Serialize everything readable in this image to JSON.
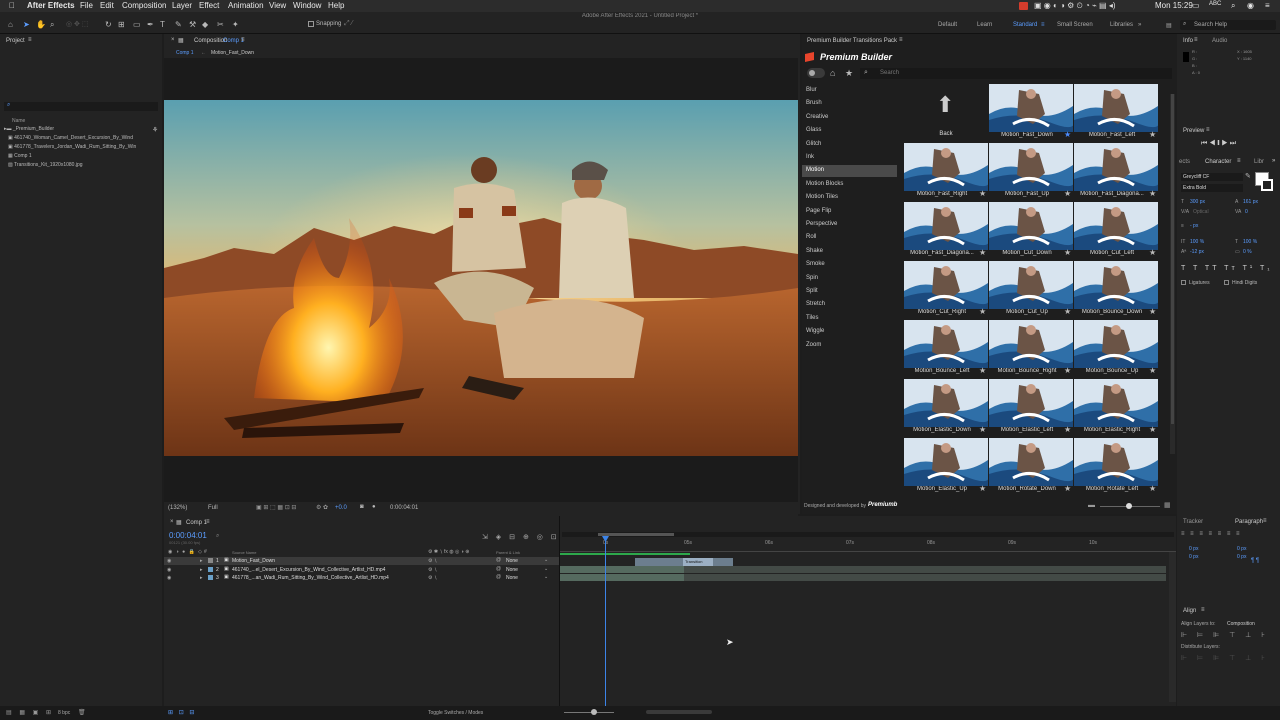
{
  "menubar": {
    "app": "After Effects",
    "items": [
      "File",
      "Edit",
      "Composition",
      "Layer",
      "Effect",
      "Animation",
      "View",
      "Window",
      "Help"
    ],
    "clock": "Mon 15:29",
    "abc": "ABC"
  },
  "window_title": "Adobe After Effects 2021 - Untitled Project *",
  "toolbar": {
    "snapping": "Snapping",
    "workspaces": [
      "Default",
      "Learn",
      "Standard",
      "Small Screen",
      "Libraries"
    ],
    "active_workspace": "Standard",
    "search_help": "Search Help"
  },
  "project": {
    "title": "Project",
    "name_header": "Name",
    "items": [
      "_Premium_Builder",
      "461740_Woman_Camel_Desert_Excursion_By_Wind",
      "461778_Travelers_Jordan_Wadi_Rum_Sitting_By_Win",
      "Comp 1",
      "Transitions_Kit_1920x1080.jpg"
    ],
    "bpc": "8 bpc"
  },
  "composition": {
    "tab_label": "Composition",
    "tab_name": "Comp 1",
    "breadcrumb": [
      "Comp 1",
      "Motion_Fast_Down"
    ],
    "zoom": "(132%)",
    "resolution": "Full",
    "timecode": "0:00:04:01",
    "exposure": "+0.0"
  },
  "premium_builder": {
    "panel_title": "Premium Builder Transitions Pack",
    "brand": "Premium Builder",
    "search_placeholder": "Search",
    "categories": [
      "Blur",
      "Brush",
      "Creative",
      "Glass",
      "Glitch",
      "Ink",
      "Motion",
      "Motion Blocks",
      "Motion Tiles",
      "Page Flip",
      "Perspective",
      "Roll",
      "Shake",
      "Smoke",
      "Spin",
      "Split",
      "Stretch",
      "Tiles",
      "Wiggle",
      "Zoom"
    ],
    "selected_category": "Motion",
    "back_label": "Back",
    "thumbnails": [
      "Motion_Fast_Down",
      "Motion_Fast_Left",
      "Motion_Fast_Right",
      "Motion_Fast_Up",
      "Motion_Fast_Diagona...",
      "Motion_Fast_Diagona...",
      "Motion_Cut_Down",
      "Motion_Cut_Left",
      "Motion_Cut_Right",
      "Motion_Cut_Up",
      "Motion_Bounce_Down",
      "Motion_Bounce_Left",
      "Motion_Bounce_Right",
      "Motion_Bounce_Up",
      "Motion_Elastic_Down",
      "Motion_Elastic_Left",
      "Motion_Elastic_Right",
      "Motion_Elastic_Up",
      "Motion_Rotate_Down",
      "Motion_Rotate_Left"
    ],
    "designed_by": "Designed and developed by",
    "signature": "Premiumb"
  },
  "info": {
    "tab": "Info",
    "tab2": "Audio",
    "r": "R :",
    "g": "G :",
    "b": "B :",
    "a": "A : 0",
    "x": "X : 1605",
    "y": "Y : 1140"
  },
  "preview": {
    "title": "Preview"
  },
  "character": {
    "tab_effects": "ects",
    "tab": "Character",
    "tab_lib": "Libr",
    "font": "Greycliff CF",
    "style": "Extra Bold",
    "size": "300 px",
    "leading": "161 px",
    "kerning": "Optical",
    "tracking": "0",
    "stroke": "- px",
    "v_scale": "100 %",
    "h_scale": "100 %",
    "baseline": "-12 px",
    "tsume": "0 %",
    "ligatures": "Ligatures",
    "hindi": "Hindi Digits"
  },
  "paragraph": {
    "tab_tracker": "Tracker",
    "tab": "Paragraph",
    "v1": "0 px",
    "v2": "0 px",
    "v3": "0 px",
    "v4": "0 px"
  },
  "align": {
    "title": "Align",
    "align_to_label": "Align Layers to:",
    "align_to": "Composition",
    "distribute": "Distribute Layers:"
  },
  "timeline": {
    "comp_tab": "Comp 1",
    "timecode": "0:00:04:01",
    "frames": "00121 (30.00 fps)",
    "source_name_header": "Source Name",
    "parent_header": "Parent & Link",
    "ruler": [
      "0s",
      "05s",
      "06s",
      "07s",
      "08s",
      "09s",
      "10s"
    ],
    "transition_label": "Transition",
    "layers": [
      {
        "num": "1",
        "name": "Motion_Fast_Down",
        "parent": "None"
      },
      {
        "num": "2",
        "name": "461740_...el_Desert_Excursion_By_Wind_Collective_Artlist_HD.mp4",
        "parent": "None"
      },
      {
        "num": "3",
        "name": "461778_...an_Wadi_Rum_Sitting_By_Wind_Collective_Artlist_HD.mp4",
        "parent": "None"
      }
    ],
    "toggle_label": "Toggle Switches / Modes"
  },
  "colors": {
    "accent": "#2f7bff",
    "label_blue": "#5b9dff",
    "selected_category": "#4a4a4a"
  }
}
